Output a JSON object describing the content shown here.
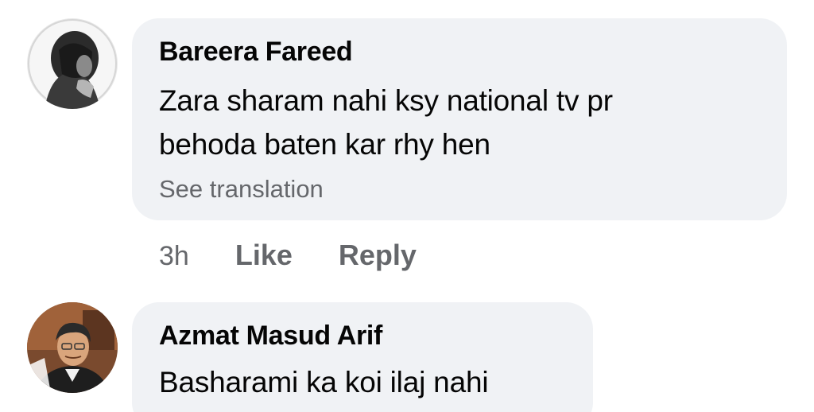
{
  "comments": [
    {
      "author": "Bareera Fareed",
      "text_lines": [
        "Zara sharam nahi ksy national tv pr",
        "behoda baten kar rhy hen"
      ],
      "translation_link": "See translation",
      "timestamp": "3h",
      "like_label": "Like",
      "reply_label": "Reply",
      "avatar_icon": "profile-photo"
    },
    {
      "author": "Azmat Masud Arif",
      "text_lines": [
        "Basharami ka koi ilaj nahi"
      ],
      "avatar_icon": "profile-photo"
    }
  ],
  "colors": {
    "bubble_background": "#f0f2f5",
    "primary_text": "#050505",
    "secondary_text": "#65676b"
  }
}
